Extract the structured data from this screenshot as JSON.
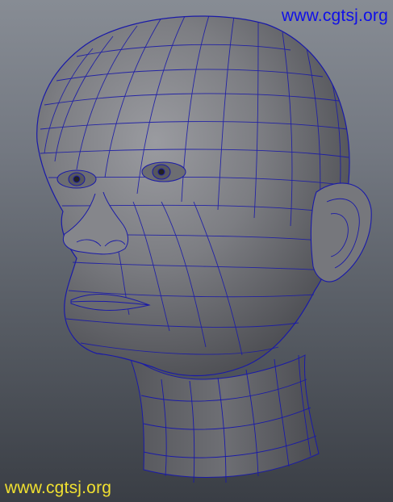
{
  "watermark_top": {
    "text": "www.cgtsj.org",
    "color": "#1010e8"
  },
  "watermark_bottom": {
    "text": "www.cgtsj.org",
    "color": "#f0e030"
  },
  "model": {
    "name": "head-wireframe-icon",
    "wire_color": "#1a1aa8",
    "surface_color": "#77787d"
  }
}
